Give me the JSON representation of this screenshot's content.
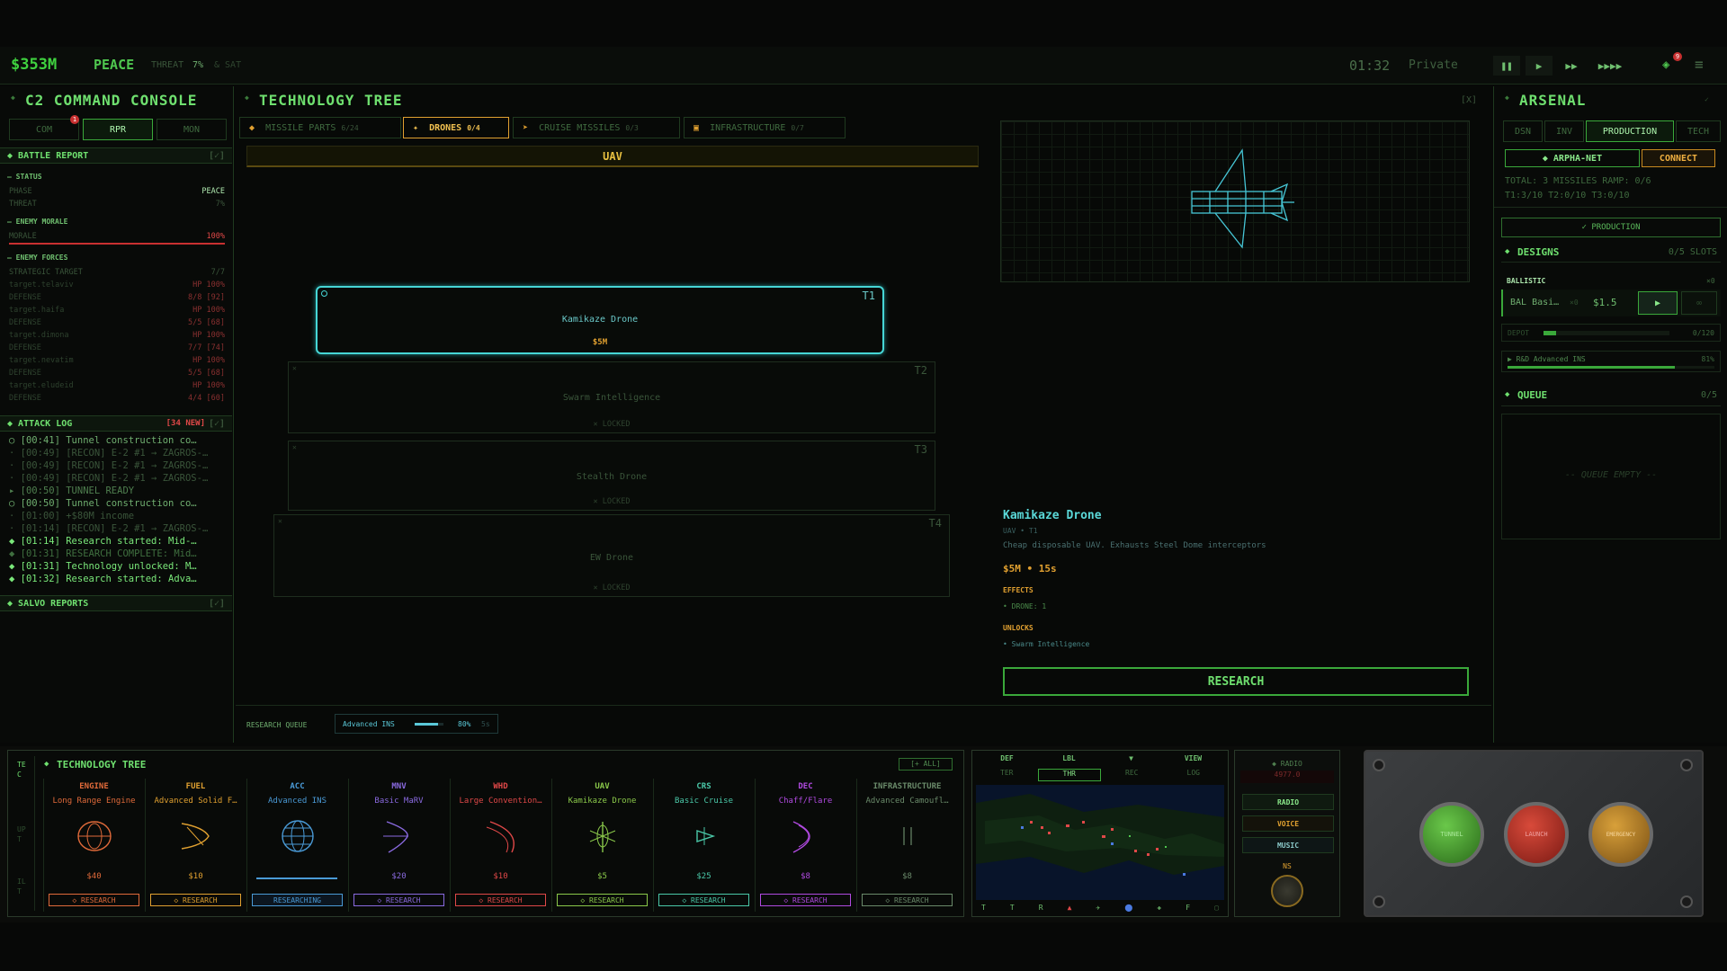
{
  "topbar": {
    "money": "$353M",
    "phase": "PEACE",
    "threat_label": "THREAT",
    "threat_value": "7%",
    "extra": "& SAT",
    "clock": "01:32",
    "rank": "Private",
    "controls": [
      "❚❚",
      "▶",
      "▶▶",
      "▶▶▶▶"
    ],
    "notif_count": "9"
  },
  "c2": {
    "title": "C2 COMMAND CONSOLE",
    "tabs": [
      "COM",
      "RPR",
      "MON"
    ],
    "badge": "1",
    "battle_report": "BATTLE REPORT",
    "status": "STATUS",
    "phase_label": "PHASE",
    "phase_value": "PEACE",
    "threat_label": "THREAT",
    "threat_value": "7%",
    "enemy_morale": "ENEMY MORALE",
    "morale_label": "MORALE",
    "morale_value": "100%",
    "enemy_forces": "ENEMY FORCES",
    "strategic_label": "STRATEGIC TARGET",
    "strategic_value": "7/7",
    "targets": [
      {
        "name": "target.telaviv",
        "hp": "HP 100%",
        "def": "8/8 [92]"
      },
      {
        "name": "target.haifa",
        "hp": "HP 100%",
        "def": "5/5 [68]"
      },
      {
        "name": "target.dimona",
        "hp": "HP 100%",
        "def": "7/7 [74]"
      },
      {
        "name": "target.nevatim",
        "hp": "HP 100%",
        "def": "5/5 [68]"
      },
      {
        "name": "target.eludeid",
        "hp": "HP 100%",
        "def": "4/4 [60]"
      }
    ],
    "defense_label": "DEFENSE",
    "attack_log": "ATTACK LOG",
    "attack_new": "[34 NEW]",
    "collapse": "[✓]",
    "logs": [
      "[00:41] Tunnel construction co…",
      "[00:49] [RECON] E-2 #1 → ZAGROS-…",
      "[00:49] [RECON] E-2 #1 → ZAGROS-…",
      "[00:49] [RECON] E-2 #1 → ZAGROS-…",
      "[00:50] TUNNEL READY",
      "[00:50] Tunnel construction co…",
      "[01:00] +$80M income",
      "[01:14] [RECON] E-2 #1 → ZAGROS-…",
      "[01:14] Research started: Mid-…",
      "[01:31] RESEARCH COMPLETE: Mid…",
      "[01:31] Technology unlocked: M…",
      "[01:32] Research started: Adva…"
    ],
    "salvo": "SALVO REPORTS"
  },
  "tree": {
    "title": "TECHNOLOGY TREE",
    "close": "[X]",
    "tabs": [
      {
        "icon": "◆",
        "label": "MISSILE PARTS",
        "count": "6/24"
      },
      {
        "icon": "✦",
        "label": "DRONES",
        "count": "0/4"
      },
      {
        "icon": "➤",
        "label": "CRUISE MISSILES",
        "count": "0/3"
      },
      {
        "icon": "▣",
        "label": "INFRASTRUCTURE",
        "count": "0/7"
      }
    ],
    "branch": "UAV",
    "nodes": [
      {
        "tier": "T1",
        "name": "Kamikaze Drone",
        "price": "$5M"
      },
      {
        "tier": "T2",
        "name": "Swarm Intelligence",
        "lock": "✕ LOCKED"
      },
      {
        "tier": "T3",
        "name": "Stealth Drone",
        "lock": "✕ LOCKED"
      },
      {
        "tier": "T4",
        "name": "EW Drone",
        "lock": "✕ LOCKED"
      }
    ],
    "queue_label": "RESEARCH QUEUE",
    "queue_item": "Advanced INS",
    "queue_pct": "80%",
    "queue_time": "5s",
    "queue_progress": 0.8
  },
  "detail": {
    "name": "Kamikaze Drone",
    "sub": "UAV • T1",
    "desc": "Cheap disposable UAV. Exhausts Steel Dome interceptors",
    "cost": "$5M • 15s",
    "effects_label": "EFFECTS",
    "effect": "• DRONE: 1",
    "unlocks_label": "UNLOCKS",
    "unlock": "• Swarm Intelligence",
    "research_btn": "RESEARCH"
  },
  "arsenal": {
    "title": "ARSENAL",
    "tabs": [
      "DSN",
      "INV",
      "PRODUCTION",
      "TECH"
    ],
    "net": "◆ ARPHA-NET",
    "connect": "CONNECT",
    "total": "TOTAL: 3 MISSILES RAMP: 0/6",
    "tiers": "T1:3/10 T2:0/10 T3:0/10",
    "production": "✓ PRODUCTION",
    "designs": "DESIGNS",
    "slots": "0/5 SLOTS",
    "ballistic": "BALLISTIC",
    "ballistic_count": "×0",
    "design_name": "BAL Basi…",
    "design_qty": "×0",
    "design_price": "$1.5",
    "depot_label": "DEPOT",
    "depot_value": "0/120",
    "depot_fill": 0.1,
    "rd_label": "▶ R&D Advanced INS",
    "rd_pct": "81%",
    "rd_fill": 0.81,
    "queue": "QUEUE",
    "queue_count": "0/5",
    "queue_empty": "-- QUEUE EMPTY --"
  },
  "bottom_tree": {
    "title": "TECHNOLOGY TREE",
    "all_btn": "[+ ALL]",
    "side_tabs": [
      "TEC",
      "UPT",
      "ILT"
    ],
    "columns": [
      {
        "cat": "ENGINE",
        "name": "Long Range Engine",
        "price": "$40",
        "btn": "◇ RESEARCH",
        "color": "#e06a3a"
      },
      {
        "cat": "FUEL",
        "name": "Advanced Solid F…",
        "price": "$10",
        "btn": "◇ RESEARCH",
        "color": "#e0a030"
      },
      {
        "cat": "ACC",
        "name": "Advanced INS",
        "price": "",
        "btn": "RESEARCHING",
        "color": "#4a9ad6"
      },
      {
        "cat": "MNV",
        "name": "Basic MaRV",
        "price": "$20",
        "btn": "◇ RESEARCH",
        "color": "#8a6ae0"
      },
      {
        "cat": "WHD",
        "name": "Large Convention…",
        "price": "$10",
        "btn": "◇ RESEARCH",
        "color": "#e04848"
      },
      {
        "cat": "UAV",
        "name": "Kamikaze Drone",
        "price": "$5",
        "btn": "◇ RESEARCH",
        "color": "#8ac84a"
      },
      {
        "cat": "CRS",
        "name": "Basic Cruise",
        "price": "$25",
        "btn": "◇ RESEARCH",
        "color": "#4ac8a8"
      },
      {
        "cat": "DEC",
        "name": "Chaff/Flare",
        "price": "$8",
        "btn": "◇ RESEARCH",
        "color": "#b04ae0"
      },
      {
        "cat": "INFRASTRUCTURE",
        "name": "Advanced Camoufl…",
        "price": "$8",
        "btn": "◇ RESEARCH",
        "color": "#6a8a6a"
      }
    ]
  },
  "map": {
    "tabs": [
      "DEF",
      "LBL",
      "▼",
      "VIEW"
    ],
    "subtabs": [
      "TER",
      "THR",
      "REC",
      "LOG"
    ],
    "bottom": [
      "T",
      "T",
      "R",
      "▲",
      "✈",
      "⬤",
      "✚",
      "F",
      "▢"
    ]
  },
  "radio": {
    "title": "◆ RADIO",
    "freq": "4977.0",
    "buttons": [
      "RADIO",
      "VOICE",
      "MUSIC"
    ],
    "knob": "NS"
  },
  "buttons_panel": {
    "labels": [
      "TUNNEL",
      "LAUNCH",
      "EMERGENCY"
    ]
  }
}
